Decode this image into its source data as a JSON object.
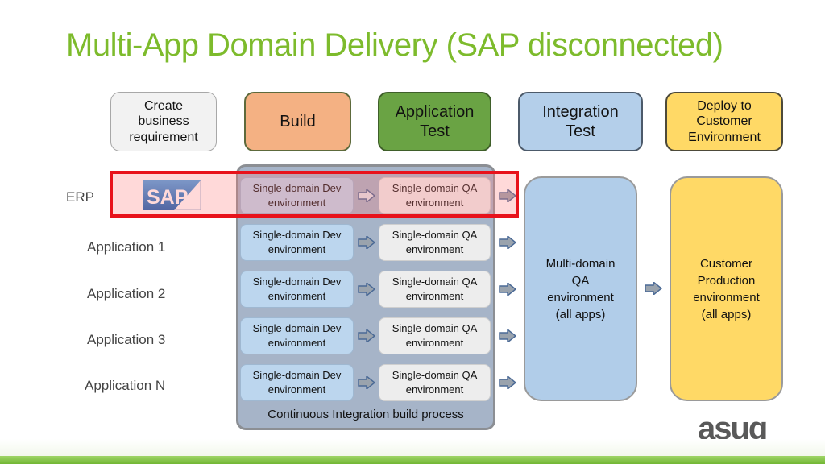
{
  "title": "Multi-App Domain Delivery (SAP disconnected)",
  "phases": [
    {
      "label": "Create\nbusiness\nrequirement",
      "color": "#f2f2f2"
    },
    {
      "label": "Build",
      "color": "#f4b183"
    },
    {
      "label": "Application\nTest",
      "color": "#70ad47"
    },
    {
      "label": "Integration\nTest",
      "color": "#b4cfea"
    },
    {
      "label": "Deploy to\nCustomer\nEnvironment",
      "color": "#ffd966"
    }
  ],
  "rows": [
    {
      "label": "ERP",
      "logo": "SAP",
      "dev": "Single-domain Dev\nenvironment",
      "qa": "Single-domain QA\nenvironment",
      "highlighted": true
    },
    {
      "label": "Application 1",
      "dev": "Single-domain Dev\nenvironment",
      "qa": "Single-domain QA\nenvironment"
    },
    {
      "label": "Application 2",
      "dev": "Single-domain Dev\nenvironment",
      "qa": "Single-domain QA\nenvironment"
    },
    {
      "label": "Application 3",
      "dev": "Single-domain Dev\nenvironment",
      "qa": "Single-domain QA\nenvironment"
    },
    {
      "label": "Application N",
      "dev": "Single-domain Dev\nenvironment",
      "qa": "Single-domain QA\nenvironment"
    }
  ],
  "ci_label": "Continuous Integration build process",
  "multi_qa": "Multi-domain\nQA\nenvironment\n(all apps)",
  "customer_prod": "Customer\nProduction\nenvironment\n(all apps)",
  "logo": "asug",
  "sap_logo_text": "SAP",
  "colors": {
    "title": "#7dbb2c",
    "highlight": "#e8121b",
    "ci_box": "#a6b4c8",
    "arrow": "#9aa3ad"
  }
}
